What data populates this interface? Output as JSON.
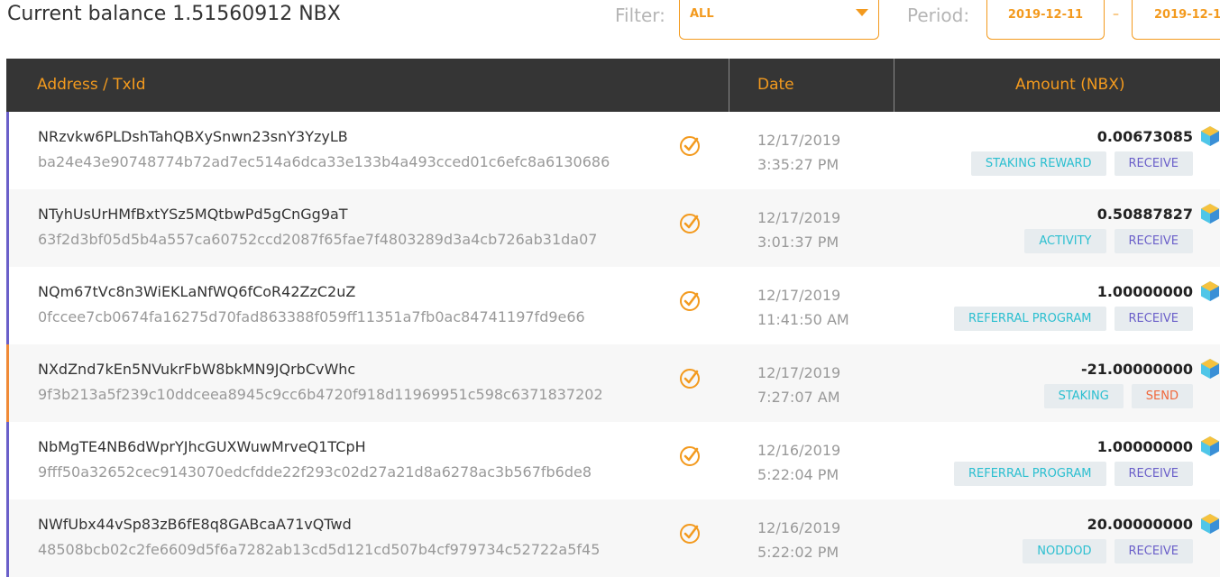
{
  "header": {
    "balance_label": "Current balance",
    "balance_value": "1.51560912 NBX",
    "filter_label": "Filter:",
    "filter_value": "ALL",
    "period_label": "Period:",
    "period_from": "2019-12-11",
    "period_separator": "–",
    "period_to": "2019-12-1"
  },
  "table": {
    "columns": [
      "Address / TxId",
      "Date",
      "Amount (NBX)"
    ],
    "rows": [
      {
        "address": "NRzvkw6PLDshTahQBXySnwn23snY3YzyLB",
        "txid": "ba24e43e90748774b72ad7ec514a6dca33e133b4a493cced01c6efc8a6130686",
        "date": "12/17/2019",
        "time": "3:35:27 PM",
        "amount": "0.00673085",
        "category": "STAKING REWARD",
        "direction": "RECEIVE"
      },
      {
        "address": "NTyhUsUrHMfBxtYSz5MQtbwPd5gCnGg9aT",
        "txid": "63f2d3bf05d5b4a557ca60752ccd2087f65fae7f4803289d3a4cb726ab31da07",
        "date": "12/17/2019",
        "time": "3:01:37 PM",
        "amount": "0.50887827",
        "category": "ACTIVITY",
        "direction": "RECEIVE"
      },
      {
        "address": "NQm67tVc8n3WiEKLaNfWQ6fCoR42ZzC2uZ",
        "txid": "0fccee7cb0674fa16275d70fad863388f059ff11351a7fb0ac84741197fd9e66",
        "date": "12/17/2019",
        "time": "11:41:50 AM",
        "amount": "1.00000000",
        "category": "REFERRAL PROGRAM",
        "direction": "RECEIVE"
      },
      {
        "address": "NXdZnd7kEn5NVukrFbW8bkMN9JQrbCvWhc",
        "txid": "9f3b213a5f239c10ddceea8945c9cc6b4720f918d11969951c598c6371837202",
        "date": "12/17/2019",
        "time": "7:27:07 AM",
        "amount": "-21.00000000",
        "category": "STAKING",
        "direction": "SEND"
      },
      {
        "address": "NbMgTE4NB6dWprYJhcGUXWuwMrveQ1TCpH",
        "txid": "9fff50a32652cec9143070edcfdde22f293c02d27a21d8a6278ac3b567fb6de8",
        "date": "12/16/2019",
        "time": "5:22:04 PM",
        "amount": "1.00000000",
        "category": "REFERRAL PROGRAM",
        "direction": "RECEIVE"
      },
      {
        "address": "NWfUbx44vSp83zB6fE8q8GABcaA71vQTwd",
        "txid": "48508bcb02c2fe6609d5f6a7282ab13cd5d121cd507b4cf979734c52722a5f45",
        "date": "12/16/2019",
        "time": "5:22:02 PM",
        "amount": "20.00000000",
        "category": "NODDOD",
        "direction": "RECEIVE"
      }
    ]
  },
  "icons": {
    "status": "check-circle-icon",
    "coin": "nbx-coin-icon"
  },
  "colors": {
    "accent": "#f39a1e",
    "header_bg": "#353535",
    "receive": "#6a5fc9",
    "category": "#2bbfd0",
    "send": "#f0673a"
  }
}
